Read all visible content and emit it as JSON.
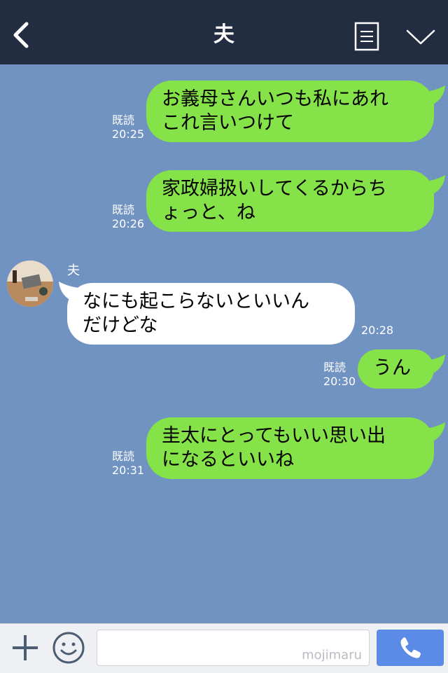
{
  "header": {
    "title": "夫"
  },
  "contact": {
    "name": "夫"
  },
  "messages": [
    {
      "side": "right",
      "lines": [
        "お義母さんいつも私にあれ",
        "これ言いつけて"
      ],
      "read": "既読",
      "time": "20:25"
    },
    {
      "side": "right",
      "lines": [
        "家政婦扱いしてくるからち",
        "ょっと、ね"
      ],
      "read": "既読",
      "time": "20:26"
    },
    {
      "side": "left",
      "lines": [
        "なにも起こらないといいん",
        "だけどな"
      ],
      "time": "20:28"
    },
    {
      "side": "right",
      "lines": [
        "うん"
      ],
      "read": "既読",
      "time": "20:30"
    },
    {
      "side": "right",
      "lines": [
        "圭太にとってもいい思い出",
        "になるといいね"
      ],
      "read": "既読",
      "time": "20:31"
    }
  ],
  "footer": {
    "input_value": "",
    "watermark": "mojimaru"
  },
  "colors": {
    "header": "#232d42",
    "chat_bg": "#7193c1",
    "own_bubble": "#85e249",
    "other_bubble": "#ffffff",
    "call_button": "#5b8be6"
  }
}
